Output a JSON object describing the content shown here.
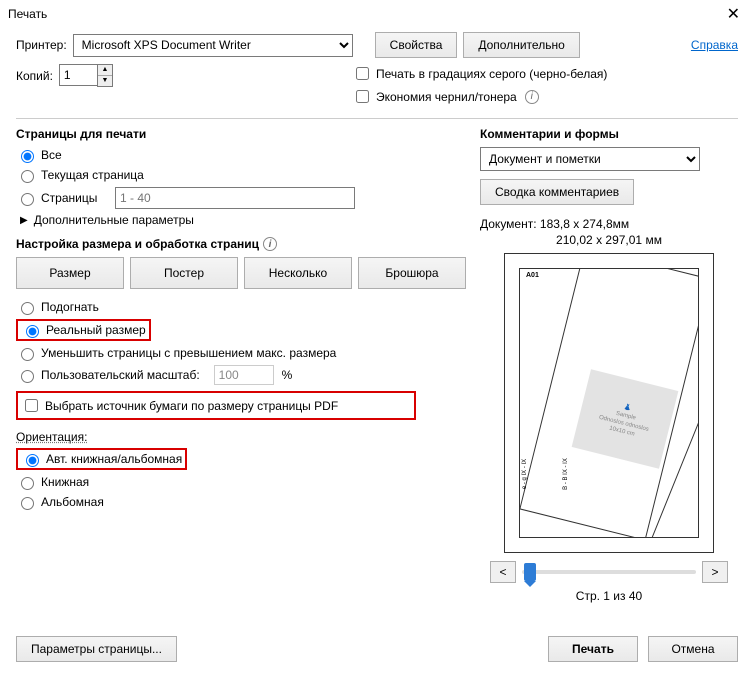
{
  "window": {
    "title": "Печать"
  },
  "top": {
    "printer_label": "Принтер:",
    "printer_value": "Microsoft XPS Document Writer",
    "properties_btn": "Свойства",
    "advanced_btn": "Дополнительно",
    "help_link": "Справка",
    "copies_label": "Копий:",
    "copies_value": "1",
    "grayscale_cb": "Печать в градациях серого (черно-белая)",
    "ink_cb": "Экономия чернил/тонера"
  },
  "pages": {
    "heading": "Страницы для печати",
    "all": "Все",
    "current": "Текущая страница",
    "range_label": "Страницы",
    "range_placeholder": "1 - 40",
    "more": "Дополнительные параметры"
  },
  "sizing": {
    "heading": "Настройка размера и обработка страниц",
    "btn_size": "Размер",
    "btn_poster": "Постер",
    "btn_multi": "Несколько",
    "btn_brochure": "Брошюра",
    "fit": "Подогнать",
    "actual": "Реальный размер",
    "shrink": "Уменьшить страницы с превышением макс. размера",
    "custom_scale": "Пользовательский масштаб:",
    "custom_scale_val": "100",
    "percent": "%",
    "paper_source": "Выбрать источник бумаги по размеру страницы PDF"
  },
  "orientation": {
    "heading": "Ориентация:",
    "auto": "Авт. книжная/альбомная",
    "portrait": "Книжная",
    "landscape": "Альбомная"
  },
  "comments": {
    "heading": "Комментарии и формы",
    "select_value": "Документ и пометки",
    "summary_btn": "Сводка комментариев"
  },
  "preview": {
    "doc_size": "Документ: 183,8 x 274,8мм",
    "paper_size": "210,02 x 297,01 мм",
    "page_tag": "A01",
    "watermark1": "Sample",
    "watermark2": "Odnoslos odnoslos",
    "watermark3": "10x10 cm",
    "page_counter": "Стр. 1 из 40"
  },
  "footer": {
    "page_setup": "Параметры страницы...",
    "print": "Печать",
    "cancel": "Отмена"
  }
}
